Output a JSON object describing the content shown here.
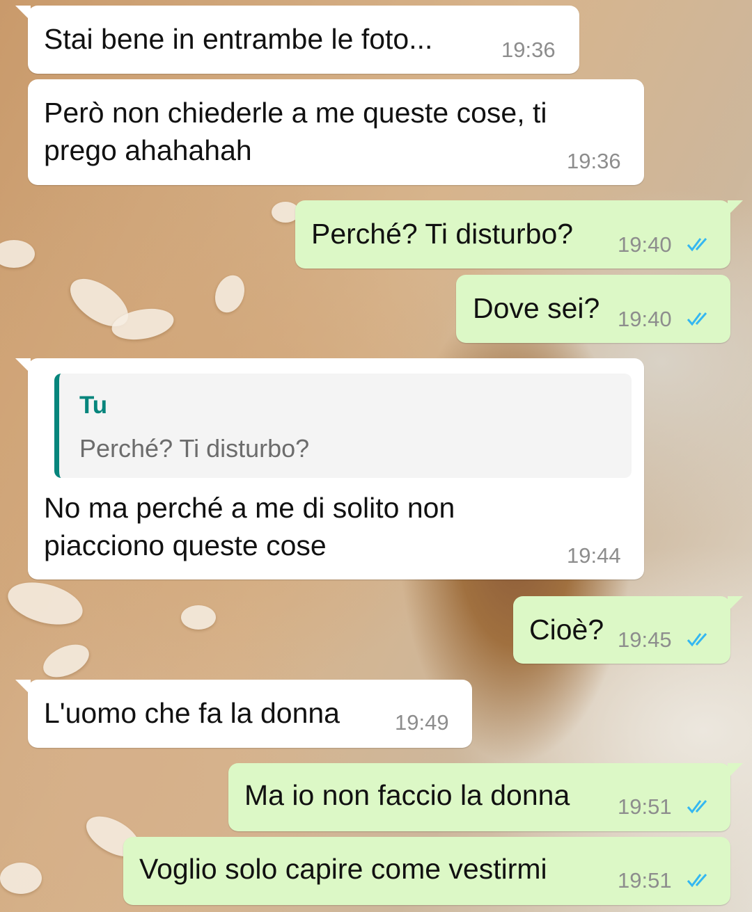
{
  "messages": [
    {
      "direction": "incoming",
      "text": "Stai bene in entrambe le foto...",
      "time": "19:36"
    },
    {
      "direction": "incoming",
      "lines": [
        "Però non chiederle a me queste cose, ti",
        "prego ahahahah"
      ],
      "time": "19:36"
    },
    {
      "direction": "outgoing",
      "text": "Perché? Ti disturbo?",
      "time": "19:40",
      "status": "read"
    },
    {
      "direction": "outgoing",
      "text": "Dove sei?",
      "time": "19:40",
      "status": "read"
    },
    {
      "direction": "incoming",
      "reply_to": {
        "author": "Tu",
        "text": "Perché? Ti disturbo?"
      },
      "lines": [
        "No ma perché a me di solito non",
        "piacciono queste cose"
      ],
      "time": "19:44"
    },
    {
      "direction": "outgoing",
      "text": "Cioè?",
      "time": "19:45",
      "status": "read"
    },
    {
      "direction": "incoming",
      "text": "L'uomo che fa la donna",
      "time": "19:49"
    },
    {
      "direction": "outgoing",
      "text": "Ma io non faccio la donna",
      "time": "19:51",
      "status": "read"
    },
    {
      "direction": "outgoing",
      "text": "Voglio solo capire come vestirmi",
      "time": "19:51",
      "status": "read"
    }
  ],
  "colors": {
    "incoming_bubble": "#ffffff",
    "outgoing_bubble": "#dcf8c6",
    "read_ticks": "#34b7f1",
    "reply_accent": "#06857c",
    "timestamp": "#8d8d8d"
  },
  "icons": {
    "read_status": "double-check-icon"
  }
}
